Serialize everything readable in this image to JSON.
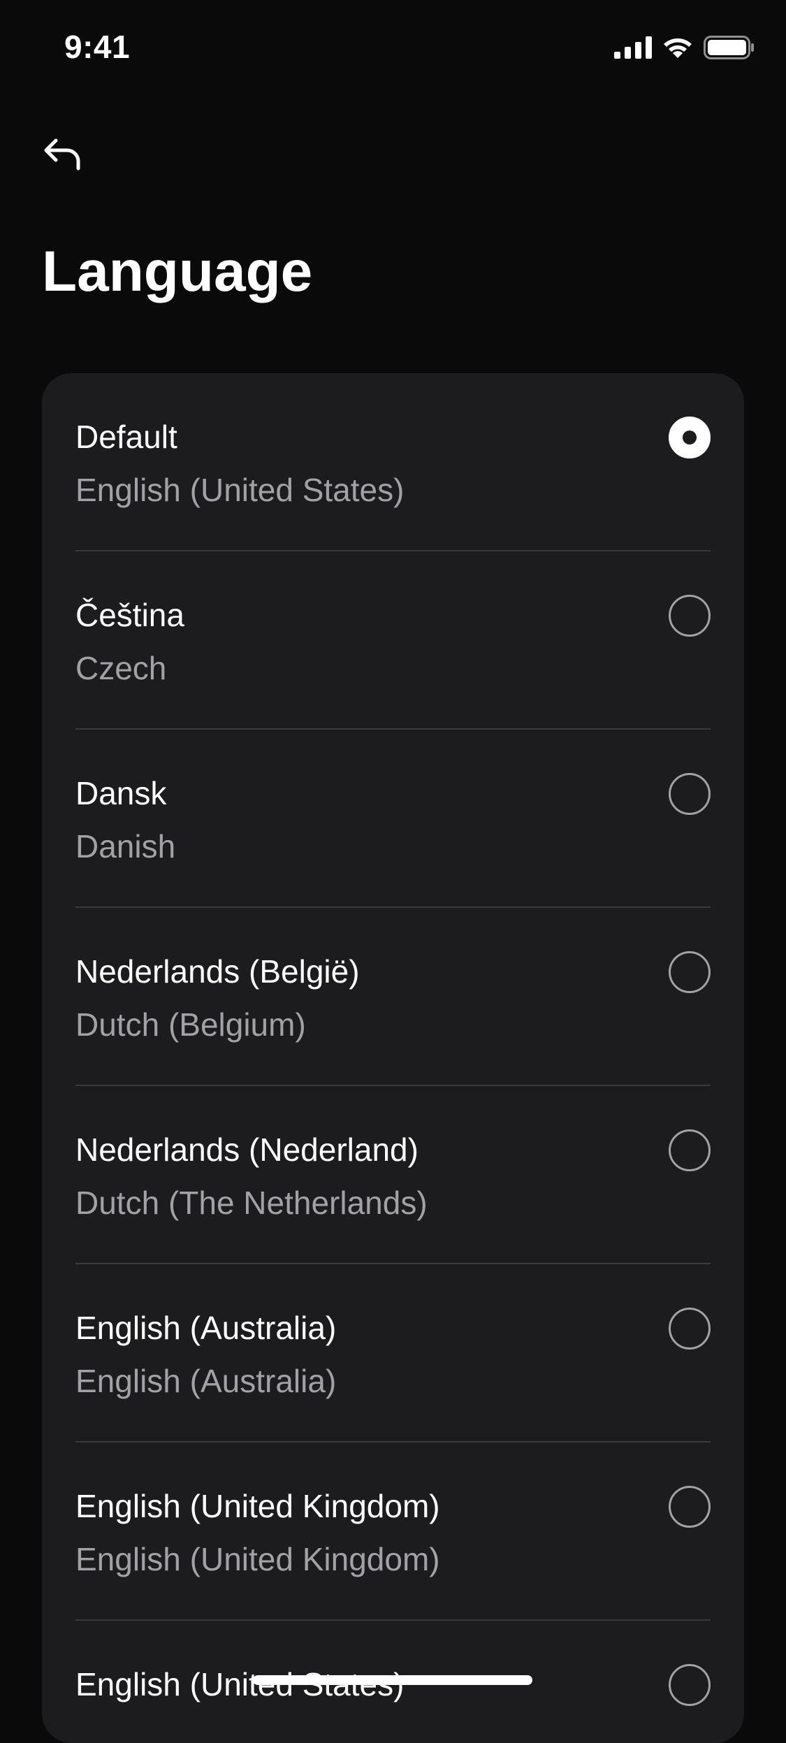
{
  "status_bar": {
    "time": "9:41",
    "icons": [
      "cellular-signal-icon",
      "wifi-icon",
      "battery-icon"
    ]
  },
  "header": {
    "back_icon": "back-arrow-icon",
    "title": "Language"
  },
  "languages": [
    {
      "native": "Default",
      "english": "English (United States)",
      "selected": true
    },
    {
      "native": "Čeština",
      "english": "Czech",
      "selected": false
    },
    {
      "native": "Dansk",
      "english": "Danish",
      "selected": false
    },
    {
      "native": "Nederlands (België)",
      "english": "Dutch (Belgium)",
      "selected": false
    },
    {
      "native": "Nederlands (Nederland)",
      "english": "Dutch (The Netherlands)",
      "selected": false
    },
    {
      "native": "English (Australia)",
      "english": "English (Australia)",
      "selected": false
    },
    {
      "native": "English (United Kingdom)",
      "english": "English (United Kingdom)",
      "selected": false
    },
    {
      "native": "English (United States)",
      "english": "",
      "selected": false
    }
  ],
  "colors": {
    "background": "#0a0a0a",
    "card": "#1c1c1e",
    "primary_text": "#ffffff",
    "secondary_text": "#a1a1a6",
    "divider": "#3a3a3c"
  }
}
